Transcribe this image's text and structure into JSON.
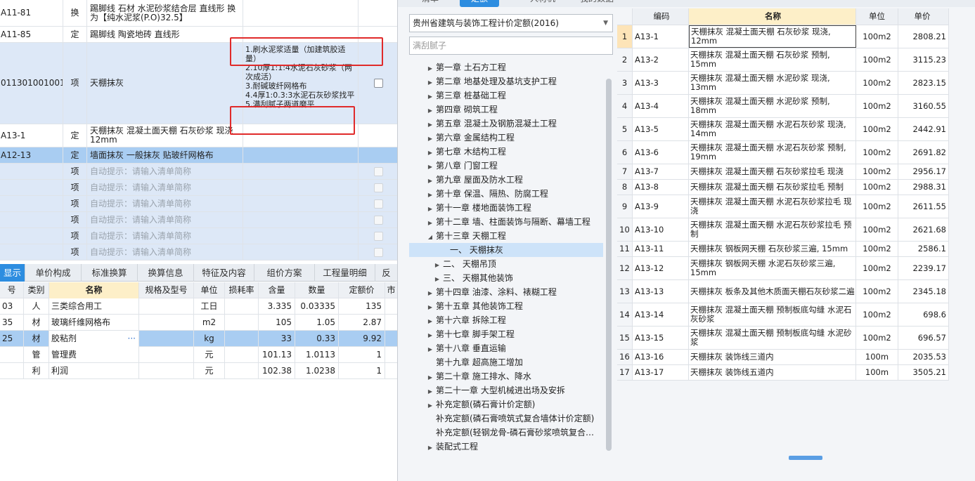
{
  "upper_rows": [
    {
      "code": "A11-81",
      "type": "换",
      "name": "踢脚线 石材 水泥砂浆结合层 直线形 换为【纯水泥浆(P.O)32.5】",
      "features": "",
      "style": ""
    },
    {
      "code": "A11-85",
      "type": "定",
      "name": "踢脚线 陶瓷地砖 直线形",
      "features": "",
      "style": ""
    },
    {
      "code": "011301001001",
      "type": "项",
      "name": "天棚抹灰",
      "features": "1.刷水泥浆适量（加建筑胶适量）\n2.10厚1:1:4水泥石灰砂浆（两次成活）\n3.耐碱玻纤网格布\n4.4厚1:0.3:3水泥石灰砂浆找平\n5.满刮腻子两道磨平",
      "style": "blue"
    },
    {
      "code": "A13-1",
      "type": "定",
      "name": "天棚抹灰 混凝土面天棚 石灰砂浆 现浇 12mm",
      "features": "",
      "style": ""
    },
    {
      "code": "A12-13",
      "type": "定",
      "name": "墙面抹灰 一般抹灰 贴玻纤网格布",
      "features": "",
      "style": "sel"
    },
    {
      "code": "",
      "type": "项",
      "name": "自动提示：请输入清单简称",
      "features": "",
      "style": "blue"
    },
    {
      "code": "",
      "type": "项",
      "name": "自动提示：请输入清单简称",
      "features": "",
      "style": "blue"
    },
    {
      "code": "",
      "type": "项",
      "name": "自动提示：请输入清单简称",
      "features": "",
      "style": "blue"
    },
    {
      "code": "",
      "type": "项",
      "name": "自动提示：请输入清单简称",
      "features": "",
      "style": "blue"
    },
    {
      "code": "",
      "type": "项",
      "name": "自动提示：请输入清单简称",
      "features": "",
      "style": "blue"
    },
    {
      "code": "",
      "type": "项",
      "name": "自动提示：请输入清单简称",
      "features": "",
      "style": "blue"
    }
  ],
  "bottom_tabs": [
    "显示",
    "单价构成",
    "标准换算",
    "换算信息",
    "特征及内容",
    "组价方案",
    "工程量明细",
    "反"
  ],
  "bottom_headers": {
    "code": "号",
    "category": "类别",
    "name": "名称",
    "spec": "规格及型号",
    "unit": "单位",
    "loss": "损耗率",
    "content": "含量",
    "quantity": "数量",
    "price": "定额价",
    "extra": "市"
  },
  "bottom_rows": [
    {
      "code": "03",
      "category": "人",
      "name": "三类综合用工",
      "spec": "",
      "unit": "工日",
      "loss": "",
      "content": "3.335",
      "quantity": "0.03335",
      "price": "135"
    },
    {
      "code": "35",
      "category": "材",
      "name": "玻璃纤维网格布",
      "spec": "",
      "unit": "m2",
      "loss": "",
      "content": "105",
      "quantity": "1.05",
      "price": "2.87"
    },
    {
      "code": "25",
      "category": "材",
      "name": "胶粘剂",
      "spec": "",
      "unit": "kg",
      "loss": "",
      "content": "33",
      "quantity": "0.33",
      "price": "9.92",
      "more": "···"
    },
    {
      "code": "",
      "category": "管",
      "name": "管理费",
      "spec": "",
      "unit": "元",
      "loss": "",
      "content": "101.13",
      "quantity": "1.0113",
      "price": "1"
    },
    {
      "code": "",
      "category": "利",
      "name": "利润",
      "spec": "",
      "unit": "元",
      "loss": "",
      "content": "102.38",
      "quantity": "1.0238",
      "price": "1"
    }
  ],
  "top_tabs": [
    "清单",
    "定额",
    "人材机",
    "我的数据"
  ],
  "quota_dropdown": "贵州省建筑与装饰工程计价定额(2016)",
  "quota_search": "满刮腻子",
  "tree_items": [
    {
      "label": "第一章 土石方工程",
      "arrow": "▶",
      "indent": 0
    },
    {
      "label": "第二章 地基处理及基坑支护工程",
      "arrow": "▶",
      "indent": 0
    },
    {
      "label": "第三章 桩基础工程",
      "arrow": "▶",
      "indent": 0
    },
    {
      "label": "第四章 砌筑工程",
      "arrow": "▶",
      "indent": 0
    },
    {
      "label": "第五章 混凝土及钢筋混凝土工程",
      "arrow": "▶",
      "indent": 0
    },
    {
      "label": "第六章 金属结构工程",
      "arrow": "▶",
      "indent": 0
    },
    {
      "label": "第七章 木结构工程",
      "arrow": "▶",
      "indent": 0
    },
    {
      "label": "第八章 门窗工程",
      "arrow": "▶",
      "indent": 0
    },
    {
      "label": "第九章 屋面及防水工程",
      "arrow": "▶",
      "indent": 0
    },
    {
      "label": "第十章 保温、隔热、防腐工程",
      "arrow": "▶",
      "indent": 0
    },
    {
      "label": "第十一章 楼地面装饰工程",
      "arrow": "▶",
      "indent": 0
    },
    {
      "label": "第十二章 墙、柱面装饰与隔断、幕墙工程",
      "arrow": "▶",
      "indent": 0
    },
    {
      "label": "第十三章 天棚工程",
      "arrow": "◢",
      "indent": 0
    },
    {
      "label": "一、 天棚抹灰",
      "arrow": "",
      "indent": 2,
      "selected": true
    },
    {
      "label": "二、 天棚吊顶",
      "arrow": "▶",
      "indent": 1
    },
    {
      "label": "三、 天棚其他装饰",
      "arrow": "▶",
      "indent": 1
    },
    {
      "label": "第十四章 油漆、涂料、裱糊工程",
      "arrow": "▶",
      "indent": 0
    },
    {
      "label": "第十五章 其他装饰工程",
      "arrow": "▶",
      "indent": 0
    },
    {
      "label": "第十六章 拆除工程",
      "arrow": "▶",
      "indent": 0
    },
    {
      "label": "第十七章 脚手架工程",
      "arrow": "▶",
      "indent": 0
    },
    {
      "label": "第十八章 垂直运输",
      "arrow": "▶",
      "indent": 0
    },
    {
      "label": "第十九章 超高施工增加",
      "arrow": "",
      "indent": 0
    },
    {
      "label": "第二十章 施工排水、降水",
      "arrow": "▶",
      "indent": 0
    },
    {
      "label": "第二十一章 大型机械进出场及安拆",
      "arrow": "▶",
      "indent": 0
    },
    {
      "label": "补充定额(磷石膏计价定额)",
      "arrow": "▶",
      "indent": 0
    },
    {
      "label": "补充定额(磷石膏喷筑式复合墙体计价定额)",
      "arrow": "",
      "indent": 0
    },
    {
      "label": "补充定额(轻钢龙骨-磷石膏砂浆喷筑复合…",
      "arrow": "",
      "indent": 0
    },
    {
      "label": "装配式工程",
      "arrow": "▶",
      "indent": 0
    }
  ],
  "quota_headers": {
    "code": "编码",
    "name": "名称",
    "unit": "单位",
    "price": "单价"
  },
  "quota_rows": [
    {
      "idx": "1",
      "code": "A13-1",
      "name": "天棚抹灰 混凝土面天棚 石灰砂浆 现浇, 12mm",
      "unit": "100m2",
      "price": "2808.21"
    },
    {
      "idx": "2",
      "code": "A13-2",
      "name": "天棚抹灰 混凝土面天棚 石灰砂浆 预制, 15mm",
      "unit": "100m2",
      "price": "3115.23"
    },
    {
      "idx": "3",
      "code": "A13-3",
      "name": "天棚抹灰 混凝土面天棚 水泥砂浆 现浇, 13mm",
      "unit": "100m2",
      "price": "2823.15"
    },
    {
      "idx": "4",
      "code": "A13-4",
      "name": "天棚抹灰 混凝土面天棚 水泥砂浆 预制, 18mm",
      "unit": "100m2",
      "price": "3160.55"
    },
    {
      "idx": "5",
      "code": "A13-5",
      "name": "天棚抹灰 混凝土面天棚 水泥石灰砂浆 现浇, 14mm",
      "unit": "100m2",
      "price": "2442.91"
    },
    {
      "idx": "6",
      "code": "A13-6",
      "name": "天棚抹灰 混凝土面天棚 水泥石灰砂浆 预制, 19mm",
      "unit": "100m2",
      "price": "2691.82"
    },
    {
      "idx": "7",
      "code": "A13-7",
      "name": "天棚抹灰 混凝土面天棚 石灰砂浆拉毛 现浇",
      "unit": "100m2",
      "price": "2956.17"
    },
    {
      "idx": "8",
      "code": "A13-8",
      "name": "天棚抹灰 混凝土面天棚 石灰砂浆拉毛 预制",
      "unit": "100m2",
      "price": "2988.31"
    },
    {
      "idx": "9",
      "code": "A13-9",
      "name": "天棚抹灰 混凝土面天棚 水泥石灰砂浆拉毛 现浇",
      "unit": "100m2",
      "price": "2611.55"
    },
    {
      "idx": "10",
      "code": "A13-10",
      "name": "天棚抹灰 混凝土面天棚 水泥石灰砂浆拉毛 预制",
      "unit": "100m2",
      "price": "2621.68"
    },
    {
      "idx": "11",
      "code": "A13-11",
      "name": "天棚抹灰 钢板网天棚 石灰砂浆三遍, 15mm",
      "unit": "100m2",
      "price": "2586.1"
    },
    {
      "idx": "12",
      "code": "A13-12",
      "name": "天棚抹灰 钢板网天棚 水泥石灰砂浆三遍, 15mm",
      "unit": "100m2",
      "price": "2239.17"
    },
    {
      "idx": "13",
      "code": "A13-13",
      "name": "天棚抹灰 板条及其他木质面天棚石灰砂浆二遍",
      "unit": "100m2",
      "price": "2345.18"
    },
    {
      "idx": "14",
      "code": "A13-14",
      "name": "天棚抹灰 混凝土面天棚 预制板底勾缝 水泥石灰砂浆",
      "unit": "100m2",
      "price": "698.6"
    },
    {
      "idx": "15",
      "code": "A13-15",
      "name": "天棚抹灰 混凝土面天棚 预制板底勾缝 水泥砂浆",
      "unit": "100m2",
      "price": "696.57"
    },
    {
      "idx": "16",
      "code": "A13-16",
      "name": "天棚抹灰 装饰线三道内",
      "unit": "100m",
      "price": "2035.53"
    },
    {
      "idx": "17",
      "code": "A13-17",
      "name": "天棚抹灰 装饰线五道内",
      "unit": "100m",
      "price": "3505.21"
    }
  ]
}
